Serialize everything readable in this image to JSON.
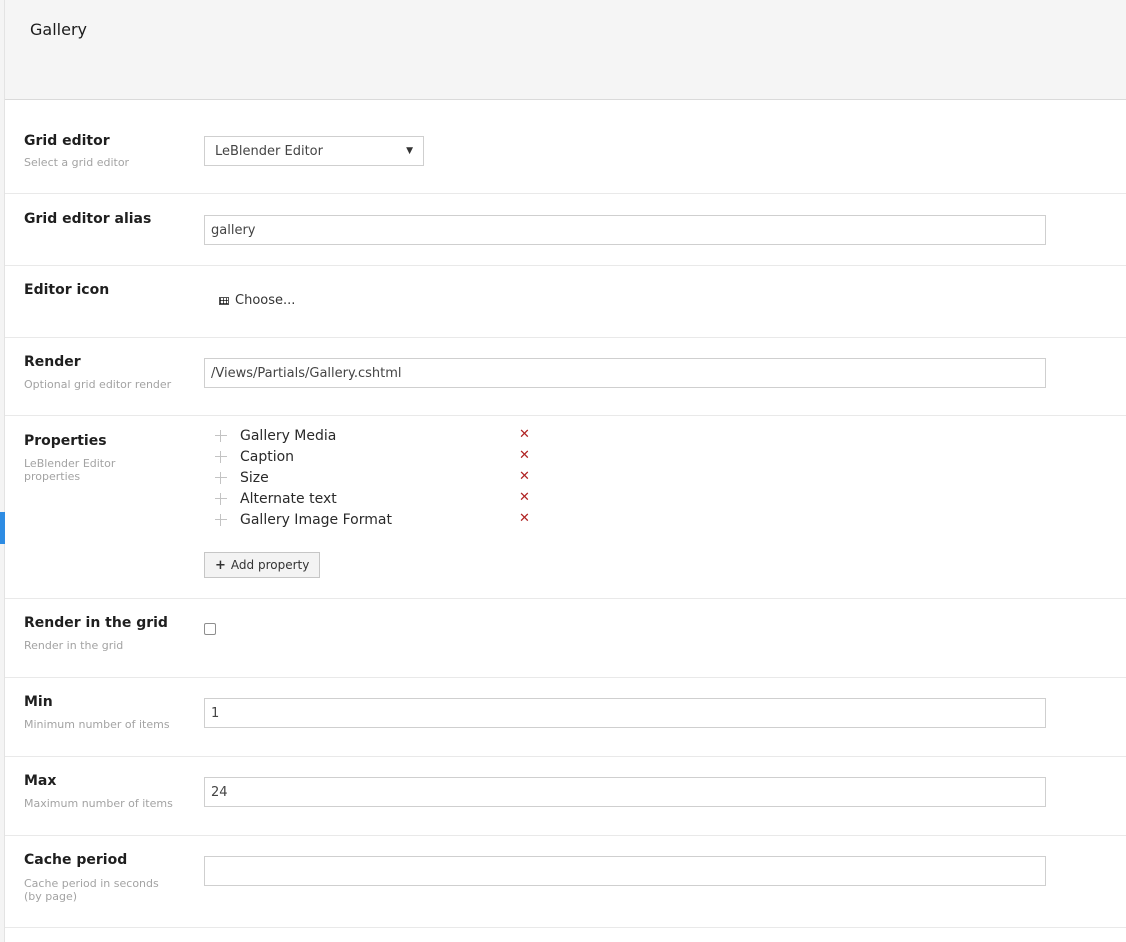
{
  "header": {
    "title": "Gallery"
  },
  "fields": {
    "grid_editor": {
      "label": "Grid editor",
      "description": "Select a grid editor",
      "selected": "LeBlender Editor"
    },
    "alias": {
      "label": "Grid editor alias",
      "value": "gallery"
    },
    "icon": {
      "label": "Editor icon",
      "choose_label": "Choose..."
    },
    "render": {
      "label": "Render",
      "description": "Optional grid editor render",
      "value": "/Views/Partials/Gallery.cshtml"
    },
    "properties": {
      "label": "Properties",
      "description": "LeBlender Editor properties",
      "items": [
        {
          "name": "Gallery Media"
        },
        {
          "name": "Caption"
        },
        {
          "name": "Size"
        },
        {
          "name": "Alternate text"
        },
        {
          "name": "Gallery Image Format"
        }
      ],
      "add_label": "Add property"
    },
    "render_in_grid": {
      "label": "Render in the grid",
      "description": "Render in the grid",
      "checked": false
    },
    "min": {
      "label": "Min",
      "description": "Minimum number of items",
      "value": "1"
    },
    "max": {
      "label": "Max",
      "description": "Maximum number of items",
      "value": "24"
    },
    "cache": {
      "label": "Cache period",
      "description": "Cache period in seconds (by page)",
      "value": ""
    }
  },
  "colors": {
    "accent": "#2e8ce3",
    "remove": "#b02323"
  }
}
